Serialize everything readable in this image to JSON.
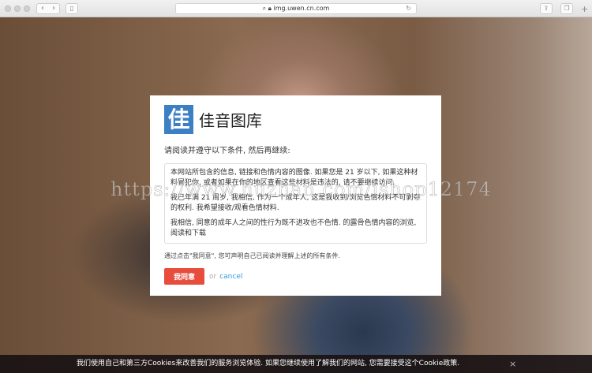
{
  "browser": {
    "url": "img.uwen.cn.com",
    "back": "‹",
    "forward": "›"
  },
  "modal": {
    "logo_char": "佳",
    "site_name": "佳音图库",
    "intro": "请阅读并遵守以下条件, 然后再继续:",
    "terms": [
      "本网站所包含的信息, 链接和色情内容的图像. 如果您是 21 岁以下, 如果这种材料冒犯你, 或者如果在你的地区查看这些材料是违法的, 请不要继续访问.",
      "我已年满 21 周岁, 我相信, 作为一个成年人, 这是我收到/浏览色情材料不可剥夺的权利. 我希望接收/观看色情材料.",
      "我相信, 同意的成年人之间的性行为既不进攻也不色情. 的露骨色情内容的浏览, 阅读和下载"
    ],
    "note": "通过点击\"我同意\", 您可声明自己已阅读并理解上述的所有条件.",
    "agree_label": "我同意",
    "or_label": "or",
    "cancel_label": "cancel"
  },
  "cookie_bar": {
    "text": "我们使用自己和第三方Cookies来改善我们的服务浏览体验. 如果您继续使用了解我们的网站, 您需要接受这个Cookie政策.",
    "close": "×"
  },
  "watermark": "https://www.huzhan.com/ishop12174",
  "colors": {
    "accent": "#e74c3c",
    "link": "#3498db",
    "logo": "#3c7fc3"
  }
}
